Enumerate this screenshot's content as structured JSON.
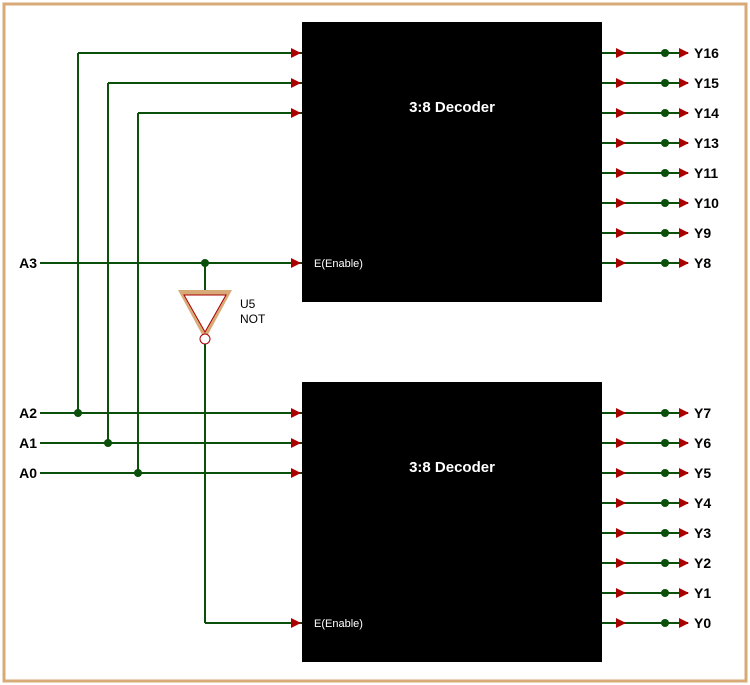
{
  "inputs": {
    "a3": "A3",
    "a2": "A2",
    "a1": "A1",
    "a0": "A0"
  },
  "decoder_top": {
    "title": "3:8 Decoder",
    "enable": "E(Enable)"
  },
  "decoder_bot": {
    "title": "3:8 Decoder",
    "enable": "E(Enable)"
  },
  "not_gate": {
    "name": "U5",
    "type": "NOT"
  },
  "outputs_top": {
    "y16": "Y16",
    "y15": "Y15",
    "y14": "Y14",
    "y13": "Y13",
    "y11": "Y11",
    "y10": "Y10",
    "y9": "Y9",
    "y8": "Y8"
  },
  "outputs_bot": {
    "y7": "Y7",
    "y6": "Y6",
    "y5": "Y5",
    "y4": "Y4",
    "y3": "Y3",
    "y2": "Y2",
    "y1": "Y1",
    "y0": "Y0"
  }
}
